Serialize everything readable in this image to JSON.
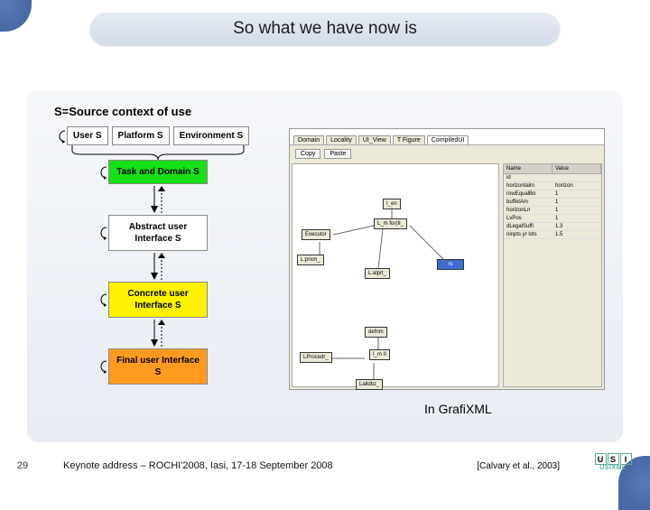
{
  "title": "So what we have now is",
  "context_label": "S=Source context of use",
  "triple": {
    "user": "User S",
    "platform": "Platform S",
    "env": "Environment S"
  },
  "levels": {
    "task": "Task and Domain S",
    "abstract": "Abstract user Interface S",
    "concrete": "Concrete user Interface S",
    "final": "Final user Interface S"
  },
  "screenshot": {
    "tabs": [
      "Domain",
      "Locality",
      "UI_View",
      "T Figure",
      "CompiledUI"
    ],
    "active_tab": 4,
    "toolbar": {
      "copy": "Copy",
      "paste": "Paste"
    },
    "nodes_top": {
      "a": "I_en",
      "b": "L_m for(II_",
      "c": "Executor",
      "d": "L:prxm_",
      "e": "L:alprt_",
      "f": "rs"
    },
    "nodes_bottom": {
      "g": "defnm",
      "h": "LProcedr_",
      "i": "I_m II",
      "j": "Lalldbz_"
    },
    "panel": {
      "headers": [
        "Name",
        "Value"
      ],
      "rows": [
        [
          "id",
          ""
        ],
        [
          "horizontalm",
          "horizon"
        ],
        [
          "rowEqualBo",
          "1"
        ],
        [
          "buffetAm",
          "1"
        ],
        [
          "horizonLn",
          "1"
        ],
        [
          "LvPos",
          "1"
        ],
        [
          "dLegalSuffi",
          "1.3"
        ],
        [
          "ninpts yr lots",
          "1.5"
        ]
      ]
    }
  },
  "tool_label": "In GrafiXML",
  "footer": {
    "page": "29",
    "text": "Keynote address – ROCHI'2008, Iasi, 17-18 September 2008",
    "citation": "[Calvary et al., 2003]"
  },
  "logo": {
    "letters": [
      "U",
      "S",
      "I"
    ],
    "sub": "USIXML"
  }
}
